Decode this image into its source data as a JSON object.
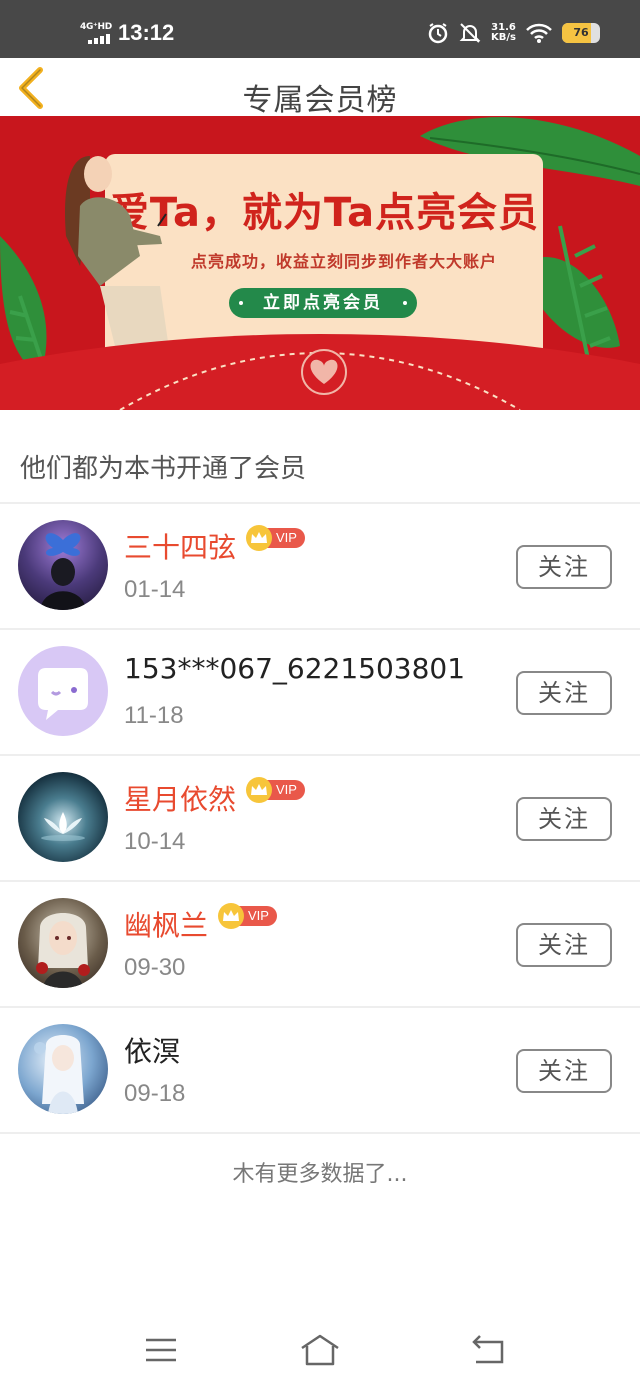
{
  "status_bar": {
    "network": "4G⁺HD",
    "time": "13:12",
    "speed_value": "31.6",
    "speed_unit": "KB/s",
    "battery": "76",
    "icons": [
      "alarm-icon",
      "mute-icon",
      "wifi-icon",
      "battery-icon"
    ]
  },
  "header": {
    "title": "专属会员榜",
    "back_icon": "chevron-left-icon",
    "accent_color": "#f2b01e"
  },
  "banner": {
    "title": "爱Ta，就为Ta点亮会员",
    "subtitle": "点亮成功，收益立刻同步到作者大大账户",
    "button_label": "立即点亮会员",
    "background_color": "#c8161d",
    "button_color": "#23894a"
  },
  "section": {
    "title": "他们都为本书开通了会员"
  },
  "vip_label": "VIP",
  "members": [
    {
      "name": "三十四弦",
      "date": "01-14",
      "vip": true,
      "follow_label": "关注",
      "avatar": "butterfly-avatar"
    },
    {
      "name": "153***067_6221503801",
      "date": "11-18",
      "vip": false,
      "follow_label": "关注",
      "avatar": "default-chat-avatar"
    },
    {
      "name": "星月依然",
      "date": "10-14",
      "vip": true,
      "follow_label": "关注",
      "avatar": "lotus-avatar"
    },
    {
      "name": "幽枫兰",
      "date": "09-30",
      "vip": true,
      "follow_label": "关注",
      "avatar": "girl-avatar"
    },
    {
      "name": "依溟",
      "date": "09-18",
      "vip": false,
      "follow_label": "关注",
      "avatar": "blue-anime-avatar"
    }
  ],
  "footer": {
    "no_more": "木有更多数据了..."
  },
  "nav_bar": {
    "icons": [
      "menu-icon",
      "home-icon",
      "back-icon"
    ]
  }
}
